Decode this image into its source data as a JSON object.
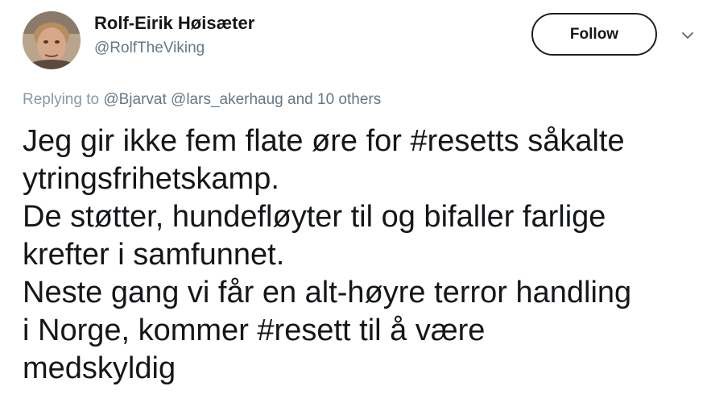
{
  "user": {
    "display_name": "Rolf-Eirik Høisæter",
    "handle": "@RolfTheViking"
  },
  "follow_button": {
    "label": "Follow"
  },
  "menu_caret": {
    "icon": "chevron-down-icon"
  },
  "reply_context": {
    "prefix": "Replying to",
    "mentions": [
      "@Bjarvat",
      "@lars_akerhaug"
    ],
    "suffix": "and 10 others"
  },
  "tweet": {
    "lines": [
      "Jeg gir ikke fem flate øre for #resetts såkalte",
      "ytringsfrihetskamp.",
      "De støtter, hundefløyter til og bifaller farlige",
      "krefter i samfunnet.",
      "Neste gang vi får en alt-høyre terror handling",
      "i Norge, kommer #resett til å være",
      "medskyldig"
    ]
  },
  "colors": {
    "text_primary": "#14171a",
    "text_secondary": "#657786",
    "text_muted": "#8899a6",
    "button_border": "#1d2124",
    "background": "#ffffff"
  }
}
